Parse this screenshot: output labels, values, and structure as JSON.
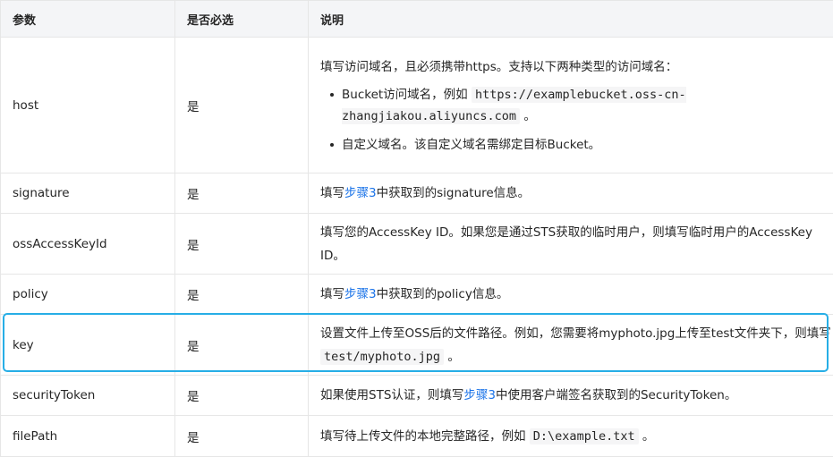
{
  "table": {
    "headers": [
      "参数",
      "是否必选",
      "说明"
    ],
    "rows": {
      "host": {
        "param": "host",
        "required": "是",
        "desc_lead": "填写访问域名，且必须携带https。支持以下两种类型的访问域名：",
        "bullet1_pre": "Bucket访问域名，例如 ",
        "bullet1_code": "https://examplebucket.oss-cn-zhangjiakou.aliyuncs.com",
        "bullet1_post": " 。",
        "bullet2": "自定义域名。该自定义域名需绑定目标Bucket。"
      },
      "signature": {
        "param": "signature",
        "required": "是",
        "desc_pre": "填写",
        "desc_link": "步骤3",
        "desc_post": "中获取到的signature信息。"
      },
      "ossAccessKeyId": {
        "param": "ossAccessKeyId",
        "required": "是",
        "desc": "填写您的AccessKey ID。如果您是通过STS获取的临时用户，则填写临时用户的AccessKey ID。"
      },
      "policy": {
        "param": "policy",
        "required": "是",
        "desc_pre": "填写",
        "desc_link": "步骤3",
        "desc_post": "中获取到的policy信息。"
      },
      "key": {
        "param": "key",
        "required": "是",
        "desc_pre": "设置文件上传至OSS后的文件路径。例如，您需要将myphoto.jpg上传至test文件夹下，则填写 ",
        "desc_code": "test/myphoto.jpg",
        "desc_post": " 。"
      },
      "securityToken": {
        "param": "securityToken",
        "required": "是",
        "desc_pre": "如果使用STS认证，则填写",
        "desc_link": "步骤3",
        "desc_post": "中使用客户端签名获取到的SecurityToken。"
      },
      "filePath": {
        "param": "filePath",
        "required": "是",
        "desc_pre": "填写待上传文件的本地完整路径，例如 ",
        "desc_code": "D:\\example.txt",
        "desc_post": " 。"
      }
    }
  },
  "colors": {
    "header_bg": "#f4f5f7",
    "border": "#e6e6e6",
    "link": "#1a73e8",
    "highlight": "#27aee6"
  }
}
